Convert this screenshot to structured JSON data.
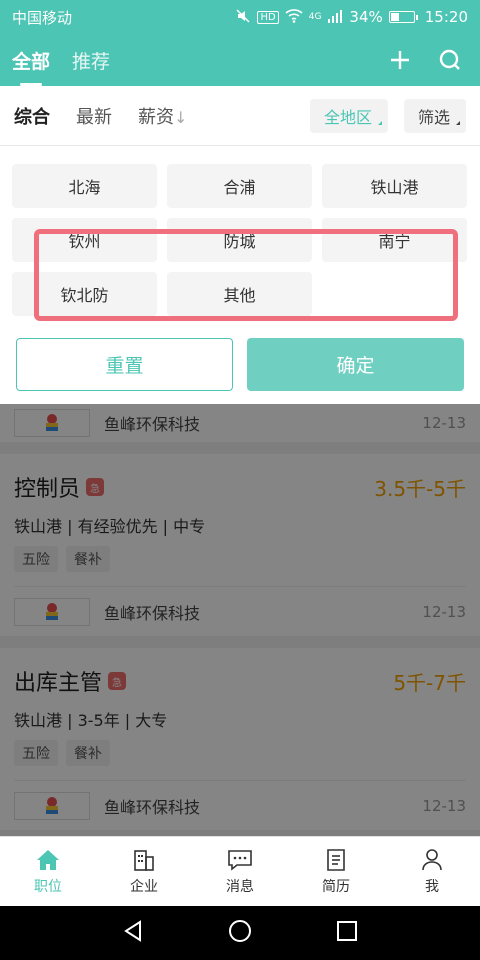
{
  "status_bar": {
    "carrier": "中国移动",
    "network": "4G",
    "battery": "34%",
    "battery_level": 0.34,
    "time": "15:20"
  },
  "header": {
    "tabs": [
      {
        "label": "全部"
      },
      {
        "label": "推荐"
      }
    ]
  },
  "filter": {
    "sorts": [
      {
        "label": "综合"
      },
      {
        "label": "最新"
      },
      {
        "label": "薪资"
      }
    ],
    "region_label": "全地区",
    "filter_label": "筛选"
  },
  "regions": [
    "北海",
    "合浦",
    "铁山港",
    "钦州",
    "防城",
    "南宁",
    "钦北防",
    "其他"
  ],
  "buttons": {
    "reset": "重置",
    "confirm": "确定"
  },
  "list": {
    "partial_company": {
      "name": "鱼峰环保科技",
      "date": "12-13"
    },
    "jobs": [
      {
        "title": "控制员",
        "urgent": "急",
        "salary": "3.5千-5千",
        "meta": "铁山港 | 有经验优先 | 中专",
        "tags": [
          "五险",
          "餐补"
        ],
        "company": "鱼峰环保科技",
        "date": "12-13"
      },
      {
        "title": "出库主管",
        "urgent": "急",
        "salary": "5千-7千",
        "meta": "铁山港 | 3-5年 | 大专",
        "tags": [
          "五险",
          "餐补"
        ],
        "company": "鱼峰环保科技",
        "date": "12-13"
      }
    ]
  },
  "bottom_nav": [
    {
      "label": "职位",
      "icon": "home-icon"
    },
    {
      "label": "企业",
      "icon": "building-icon"
    },
    {
      "label": "消息",
      "icon": "message-icon"
    },
    {
      "label": "简历",
      "icon": "resume-icon"
    },
    {
      "label": "我",
      "icon": "profile-icon"
    }
  ],
  "colors": {
    "accent": "#4dc5b4",
    "salary": "#f4a100",
    "urgent": "#f06b6b",
    "highlight": "#ef6f7c"
  }
}
